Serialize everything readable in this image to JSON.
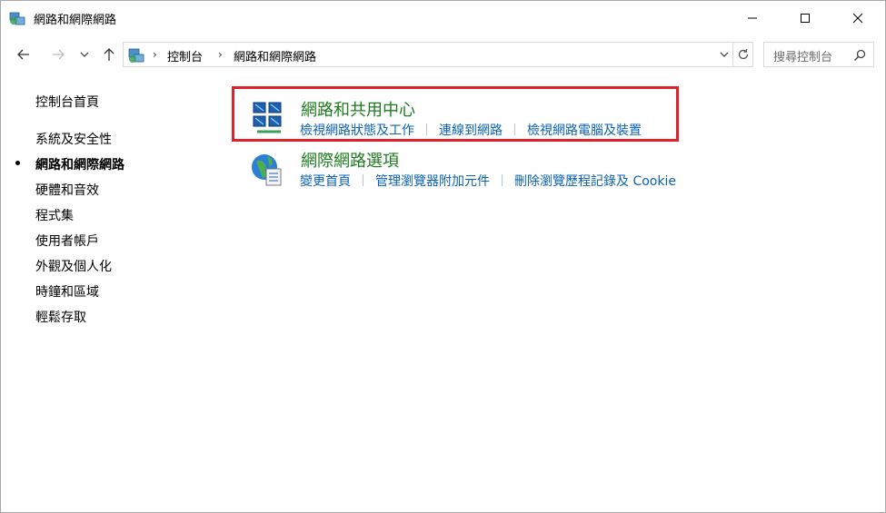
{
  "window": {
    "title": "網路和網際網路",
    "controls": {
      "minimize": "minimize",
      "maximize": "maximize",
      "close": "close"
    }
  },
  "address_bar": {
    "breadcrumbs": [
      "控制台",
      "網路和網際網路"
    ],
    "search_placeholder": "搜尋控制台"
  },
  "sidebar": {
    "items": [
      {
        "label": "控制台首頁",
        "current": false
      },
      {
        "label": "系統及安全性",
        "current": false
      },
      {
        "label": "網路和網際網路",
        "current": true
      },
      {
        "label": "硬體和音效",
        "current": false
      },
      {
        "label": "程式集",
        "current": false
      },
      {
        "label": "使用者帳戶",
        "current": false
      },
      {
        "label": "外觀及個人化",
        "current": false
      },
      {
        "label": "時鐘和區域",
        "current": false
      },
      {
        "label": "輕鬆存取",
        "current": false
      }
    ]
  },
  "categories": [
    {
      "title": "網路和共用中心",
      "icon": "network-sharing-icon",
      "highlighted": true,
      "links": [
        "檢視網路狀態及工作",
        "連線到網路",
        "檢視網路電腦及裝置"
      ]
    },
    {
      "title": "網際網路選項",
      "icon": "internet-options-icon",
      "highlighted": false,
      "links": [
        "變更首頁",
        "管理瀏覽器附加元件",
        "刪除瀏覽歷程記錄及 Cookie"
      ]
    }
  ],
  "colors": {
    "category_title": "#1e7b1e",
    "link": "#0b62b1",
    "highlight_border": "#e0202a"
  }
}
